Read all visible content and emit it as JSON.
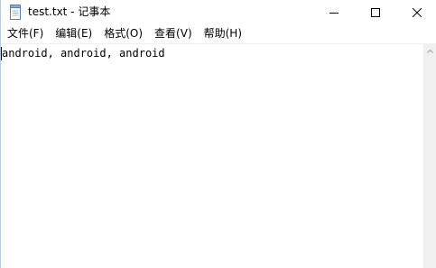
{
  "window": {
    "title": "test.txt - 记事本"
  },
  "caption_buttons": {
    "minimize_icon": "minimize-icon",
    "maximize_icon": "maximize-icon",
    "close_icon": "close-icon"
  },
  "menu": {
    "items": [
      {
        "label": "文件(F)"
      },
      {
        "label": "编辑(E)"
      },
      {
        "label": "格式(O)"
      },
      {
        "label": "查看(V)"
      },
      {
        "label": "帮助(H)"
      }
    ]
  },
  "editor": {
    "content": "android, android, android"
  },
  "colors": {
    "border_accent": "#b9c9dc",
    "scrollbar_bg": "#f0f0f0"
  }
}
